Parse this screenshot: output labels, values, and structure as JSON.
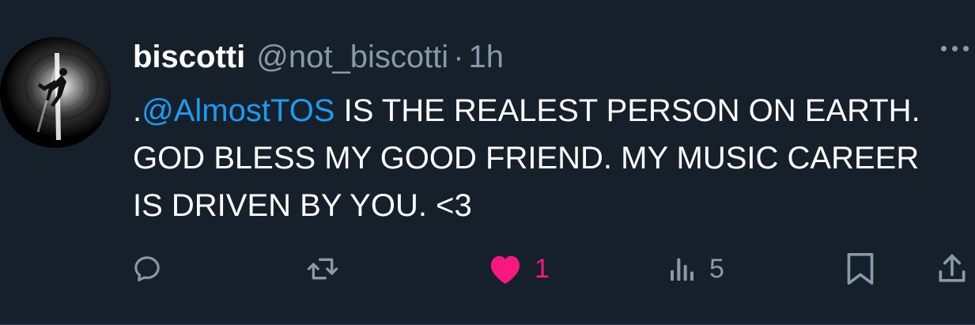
{
  "tweet": {
    "author": {
      "display_name": "biscotti",
      "handle": "@not_biscotti"
    },
    "separator": "·",
    "timestamp": "1h",
    "text_prefix": ".",
    "mention": "@AlmostTOS",
    "text_rest": " IS THE REALEST PERSON ON EARTH. GOD BLESS MY GOOD FRIEND. MY MUSIC CAREER IS DRIVEN BY YOU. <3",
    "actions": {
      "reply_icon": "reply-icon",
      "retweet_icon": "retweet-icon",
      "like_icon": "heart-icon",
      "like_count": "1",
      "like_state": "liked",
      "views_icon": "views-icon",
      "views_count": "5",
      "bookmark_icon": "bookmark-icon",
      "share_icon": "share-icon"
    },
    "colors": {
      "background": "#15202b",
      "muted": "#8b98a5",
      "link": "#1d9bf0",
      "like": "#f91880"
    }
  }
}
